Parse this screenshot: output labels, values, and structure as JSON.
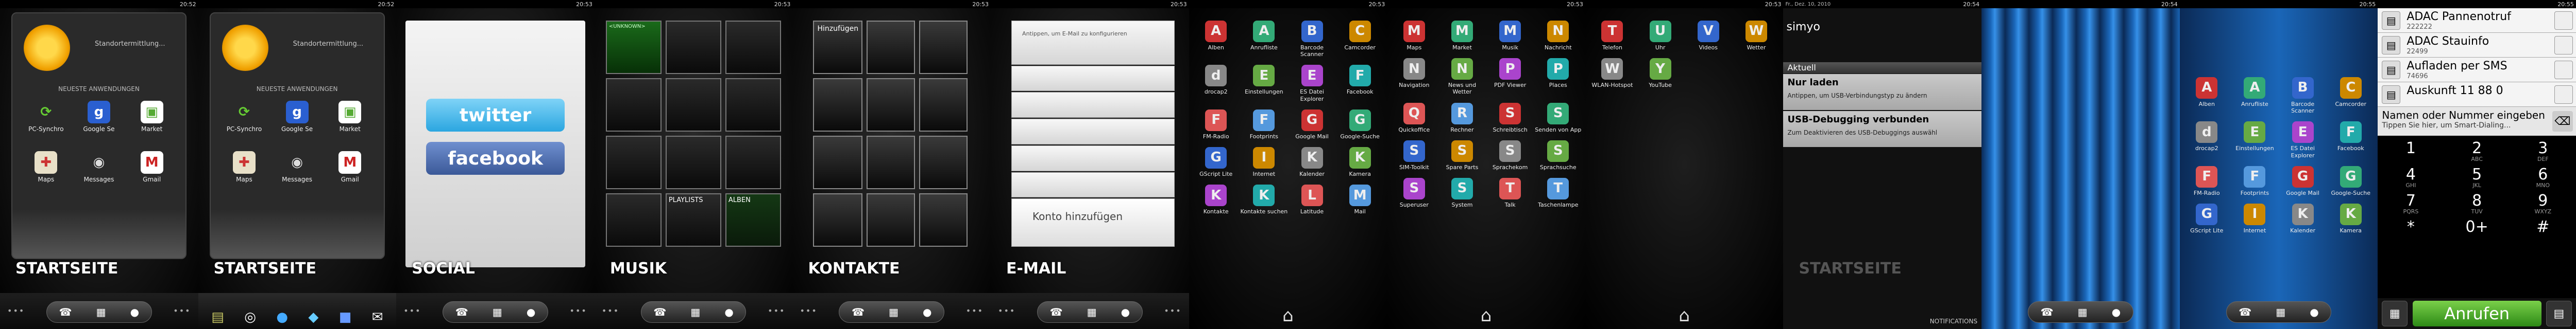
{
  "status_time": [
    "20:52",
    "20:52",
    "20:53",
    "20:53",
    "20:53",
    "20:53",
    "20:53",
    "20:53",
    "20:53",
    "20:54",
    "20:54",
    "20:55",
    "20:55"
  ],
  "panel1": {
    "weather_text": "Standortermittlung...",
    "section": "NEUESTE ANWENDUNGEN",
    "apps": [
      "PC-Synchro",
      "Google Se",
      "Market",
      "Maps",
      "Messages",
      "Gmail"
    ],
    "scene_label": "STARTSEITE"
  },
  "panel2": {
    "weather_text": "Standortermittlung...",
    "section": "NEUESTE ANWENDUNGEN",
    "apps": [
      "PC-Synchro",
      "Google Se",
      "Market",
      "Maps",
      "Messages",
      "Gmail"
    ],
    "scene_label": "STARTSEITE"
  },
  "panel3": {
    "twitter": "twitter",
    "facebook": "facebook",
    "scene_label": "SOCIAL"
  },
  "panel4": {
    "unknown": "<UNKNOWN>",
    "playlists": "PLAYLISTS",
    "alben": "ALBEN",
    "scene_label": "MUSIK"
  },
  "panel5": {
    "add": "Hinzufügen",
    "scene_label": "KONTAKTE"
  },
  "panel6": {
    "hint": "Antippen, um E-Mail zu konfigurieren",
    "add_account": "Konto hinzufügen",
    "scene_label": "E-MAIL"
  },
  "panel7": {
    "apps": [
      "Alben",
      "Anrufliste",
      "Barcode Scanner",
      "Camcorder",
      "drocap2",
      "Einstellungen",
      "ES Datei Explorer",
      "Facebook",
      "FM-Radio",
      "Footprints",
      "Google Mail",
      "Google-Suche",
      "GScript Lite",
      "Internet",
      "Kalender",
      "Kamera",
      "Kontakte",
      "Kontakte suchen",
      "Latitude",
      "Mail"
    ]
  },
  "panel8": {
    "apps": [
      "Maps",
      "Market",
      "Musik",
      "Nachricht",
      "Navigation",
      "News und Wetter",
      "PDF Viewer",
      "Places",
      "Quickoffice",
      "Rechner",
      "Schreibtisch",
      "Senden von App",
      "SIM-Toolkit",
      "Spare Parts",
      "Sprachekom",
      "Sprachsuche",
      "Superuser",
      "System",
      "Talk",
      "Taschenlampe"
    ]
  },
  "panel9": {
    "apps": [
      "Telefon",
      "Uhr",
      "Videos",
      "Wetter",
      "WLAN-Hotspot",
      "YouTube"
    ]
  },
  "panel10": {
    "status_date": "Fr., Dez. 10, 2010",
    "carrier": "simyo",
    "section": "Aktuell",
    "n1_title": "Nur laden",
    "n1_sub": "Antippen, um USB-Verbindungstyp zu ändern",
    "n2_title": "USB-Debugging verbunden",
    "n2_sub": "Zum Deaktivieren des USB-Debuggings auswähl",
    "scene_label": "STARTSEITE",
    "footer": "NOTIFICATIONS"
  },
  "panel12": {
    "apps": [
      "Alben",
      "Anrufliste",
      "Barcode Scanner",
      "Camcorder",
      "drocap2",
      "Einstellungen",
      "ES Datei Explorer",
      "Facebook",
      "FM-Radio",
      "Footprints",
      "Google Mail",
      "Google-Suche",
      "GScript Lite",
      "Internet",
      "Kalender",
      "Kamera"
    ]
  },
  "panel13": {
    "contacts": [
      {
        "name": "ADAC Pannenotruf",
        "number": "222222"
      },
      {
        "name": "ADAC Stauinfo",
        "number": "22499"
      },
      {
        "name": "Aufladen per SMS",
        "number": "74696"
      },
      {
        "name": "Auskunft 11 88 0",
        "number": ""
      }
    ],
    "input_label": "Namen oder Nummer eingeben",
    "input_hint": "Tippen Sie hier, um Smart-Dialing...",
    "keys": [
      {
        "d": "1",
        "l": ""
      },
      {
        "d": "2",
        "l": "ABC"
      },
      {
        "d": "3",
        "l": "DEF"
      },
      {
        "d": "4",
        "l": "GHI"
      },
      {
        "d": "5",
        "l": "JKL"
      },
      {
        "d": "6",
        "l": "MNO"
      },
      {
        "d": "7",
        "l": "PQRS"
      },
      {
        "d": "8",
        "l": "TUV"
      },
      {
        "d": "9",
        "l": "WXYZ"
      },
      {
        "d": "*",
        "l": ""
      },
      {
        "d": "0+",
        "l": ""
      },
      {
        "d": "#",
        "l": ""
      }
    ],
    "call": "Anrufen"
  }
}
